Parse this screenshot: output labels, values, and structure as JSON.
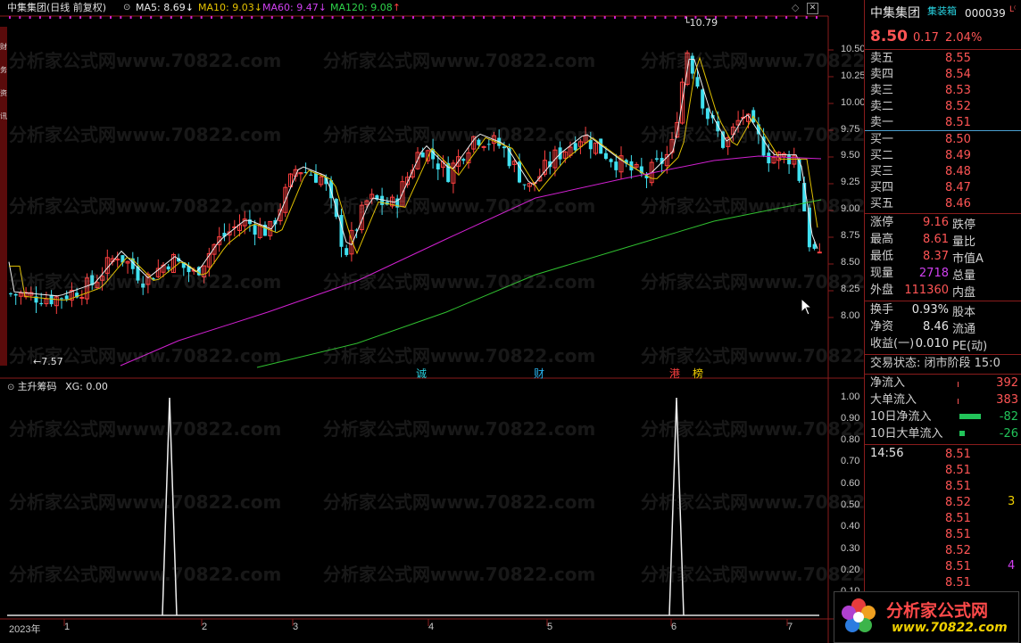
{
  "stock": {
    "name": "中集集团",
    "code": "000039",
    "tag": "集装箱",
    "price": "8.50",
    "change": "0.17",
    "pct": "2.04%"
  },
  "header": {
    "title": "中集集团(日线 前复权)",
    "ma5": "MA5: 8.69",
    "ma10": "MA10: 9.03",
    "ma60": "MA60: 9.47",
    "ma120": "MA120: 9.08"
  },
  "sub_header": {
    "title": "主升筹码",
    "xg": "XG: 0.00"
  },
  "annotations": {
    "high": "10.79",
    "low": "7.57",
    "events": [
      "诚",
      "财",
      "港",
      "榜"
    ]
  },
  "watermark": "分析家公式网www.70822.com",
  "x_axis": [
    "2023年",
    "1",
    "2",
    "3",
    "4",
    "5",
    "6",
    "7"
  ],
  "y_axis_main": [
    "10.50",
    "10.25",
    "10.00",
    "9.75",
    "9.50",
    "9.25",
    "9.00",
    "8.75",
    "8.50",
    "8.25",
    "8.00"
  ],
  "y_axis_sub": [
    "1.00",
    "0.90",
    "0.80",
    "0.70",
    "0.60",
    "0.50",
    "0.40",
    "0.30",
    "0.20",
    "0.10"
  ],
  "order_book": {
    "asks": [
      {
        "label": "卖五",
        "price": "8.55"
      },
      {
        "label": "卖四",
        "price": "8.54"
      },
      {
        "label": "卖三",
        "price": "8.53"
      },
      {
        "label": "卖二",
        "price": "8.52"
      },
      {
        "label": "卖一",
        "price": "8.51"
      }
    ],
    "bids": [
      {
        "label": "买一",
        "price": "8.50"
      },
      {
        "label": "买二",
        "price": "8.49"
      },
      {
        "label": "买三",
        "price": "8.48"
      },
      {
        "label": "买四",
        "price": "8.47"
      },
      {
        "label": "买五",
        "price": "8.46"
      }
    ]
  },
  "stats": [
    {
      "label": "涨停",
      "value": "9.16",
      "label2": "跌停"
    },
    {
      "label": "最高",
      "value": "8.61",
      "label2": "量比"
    },
    {
      "label": "最低",
      "value": "8.37",
      "label2": "市值A"
    },
    {
      "label": "现量",
      "value": "2718",
      "label2": "总量"
    },
    {
      "label": "外盘",
      "value": "111360",
      "label2": "内盘"
    }
  ],
  "stats2": [
    {
      "label": "换手",
      "value": "0.93%",
      "label2": "股本"
    },
    {
      "label": "净资",
      "value": "8.46",
      "label2": "流通"
    },
    {
      "label": "收益(一)",
      "value": "0.010",
      "label2": "PE(动)"
    }
  ],
  "trade_state": "交易状态: 闭市阶段 15:0",
  "flows": [
    {
      "label": "净流入",
      "value": "392"
    },
    {
      "label": "大单流入",
      "value": "383"
    },
    {
      "label": "10日净流入",
      "value": "-82"
    },
    {
      "label": "10日大单流入",
      "value": "-26"
    }
  ],
  "ticks": {
    "time": "14:56",
    "prices": [
      "8.51",
      "8.51",
      "8.51",
      "8.52",
      "8.51",
      "8.51",
      "8.52",
      "8.51",
      "8.51"
    ],
    "side_vals": [
      "3",
      "4"
    ]
  },
  "logo": {
    "title": "分析家公式网",
    "url": "www.70822.com"
  },
  "left_tabs": [
    "财",
    "务",
    "资",
    "讯"
  ]
}
